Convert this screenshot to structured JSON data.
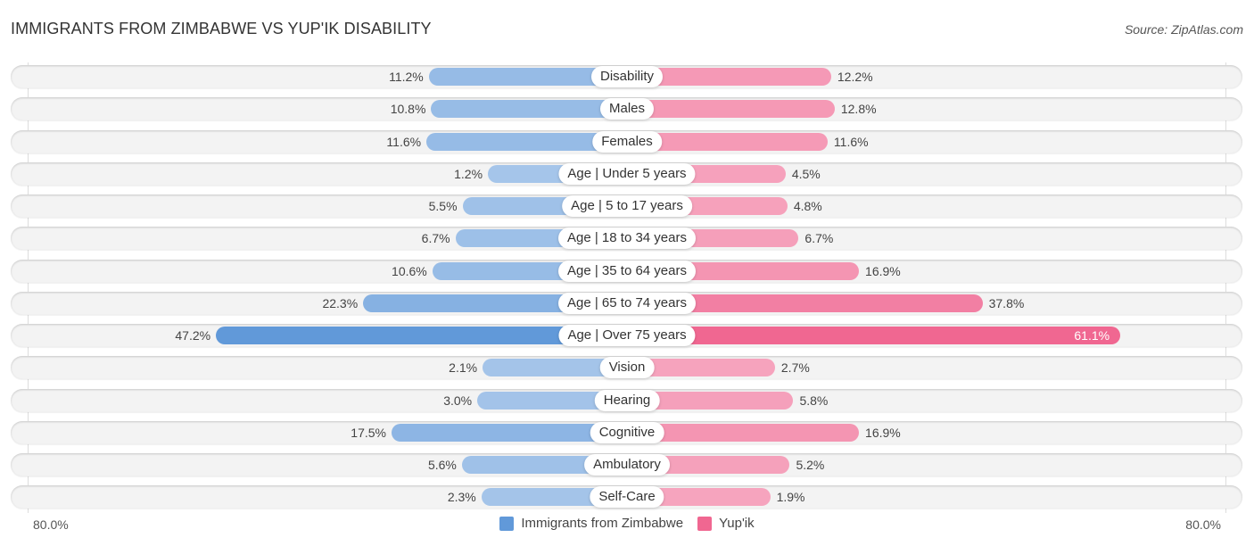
{
  "header": {
    "title": "IMMIGRANTS FROM ZIMBABWE VS YUP'IK DISABILITY",
    "source": "Source: ZipAtlas.com"
  },
  "colors": {
    "left_light": "#a7c6ea",
    "left_strong": "#6199d9",
    "right_light": "#f6a6bf",
    "right_strong": "#f06791"
  },
  "axis": {
    "left_label": "80.0%",
    "right_label": "80.0%"
  },
  "legend": [
    {
      "name": "Immigrants from Zimbabwe",
      "color": "#6199d9"
    },
    {
      "name": "Yup'ik",
      "color": "#f06791"
    }
  ],
  "chart_data": {
    "type": "bar",
    "orientation": "horizontal-diverging",
    "title": "IMMIGRANTS FROM ZIMBABWE VS YUP'IK DISABILITY",
    "xlim": [
      -80,
      80
    ],
    "categories": [
      "Disability",
      "Males",
      "Females",
      "Age | Under 5 years",
      "Age | 5 to 17 years",
      "Age | 18 to 34 years",
      "Age | 35 to 64 years",
      "Age | 65 to 74 years",
      "Age | Over 75 years",
      "Vision",
      "Hearing",
      "Cognitive",
      "Ambulatory",
      "Self-Care"
    ],
    "series": [
      {
        "name": "Immigrants from Zimbabwe",
        "side": "left",
        "values": [
          11.2,
          10.8,
          11.6,
          1.2,
          5.5,
          6.7,
          10.6,
          22.3,
          47.2,
          2.1,
          3.0,
          17.5,
          5.6,
          2.3
        ],
        "labels": [
          "11.2%",
          "10.8%",
          "11.6%",
          "1.2%",
          "5.5%",
          "6.7%",
          "10.6%",
          "22.3%",
          "47.2%",
          "2.1%",
          "3.0%",
          "17.5%",
          "5.6%",
          "2.3%"
        ]
      },
      {
        "name": "Yup'ik",
        "side": "right",
        "values": [
          12.2,
          12.8,
          11.6,
          4.5,
          4.8,
          6.7,
          16.9,
          37.8,
          61.1,
          2.7,
          5.8,
          16.9,
          5.2,
          1.9
        ],
        "labels": [
          "12.2%",
          "12.8%",
          "11.6%",
          "4.5%",
          "4.8%",
          "6.7%",
          "16.9%",
          "37.8%",
          "61.1%",
          "2.7%",
          "5.8%",
          "16.9%",
          "5.2%",
          "1.9%"
        ]
      }
    ],
    "legend_position": "bottom-center"
  }
}
